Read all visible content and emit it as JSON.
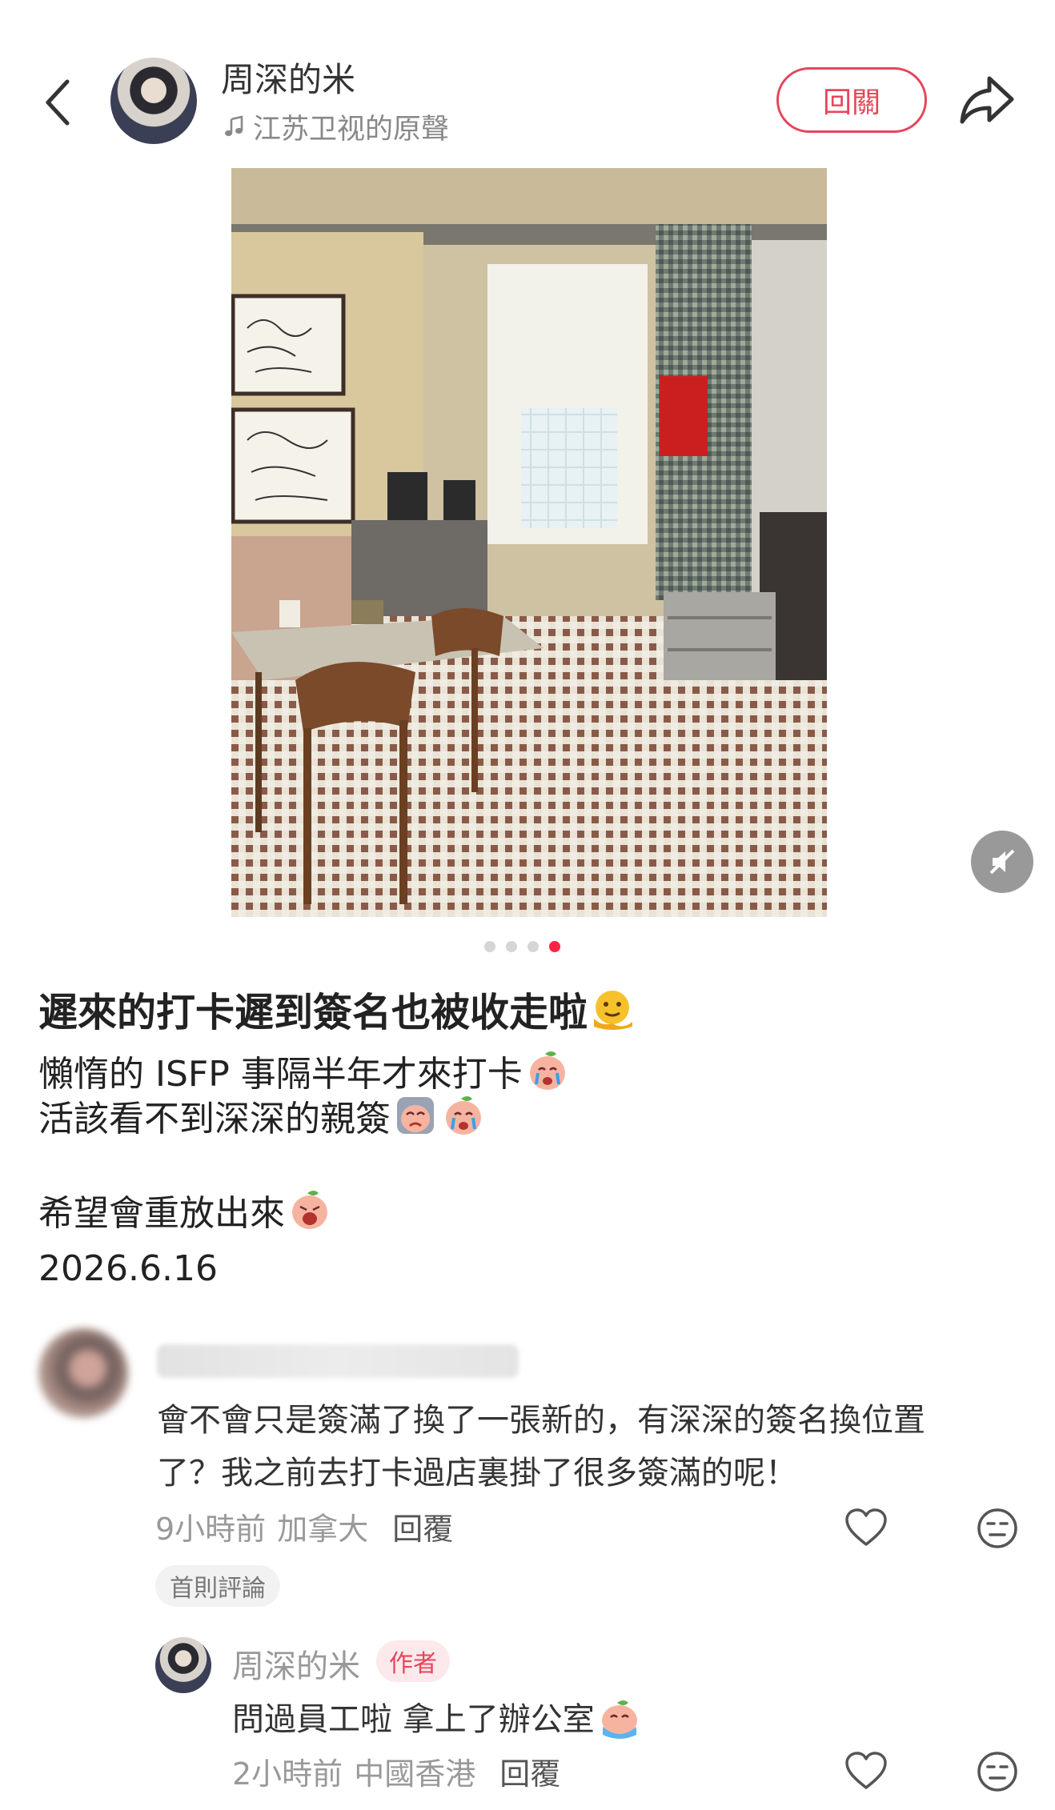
{
  "header": {
    "author_name": "周深的米",
    "music": "江苏卫视的原聲",
    "follow_label": "回關"
  },
  "carousel": {
    "total": 4,
    "current": 4
  },
  "post": {
    "title": "遲來的打卡遲到簽名也被收走啦",
    "lines": [
      "懶惰的 ISFP 事隔半年才來打卡",
      "活該看不到深深的親簽",
      "希望會重放出來"
    ],
    "date": "2026.6.16"
  },
  "comments": [
    {
      "text": "會不會只是簽滿了換了一張新的，有深深的簽名換位置了？我之前去打卡過店裏掛了很多簽滿的呢！",
      "time": "9小時前",
      "location": "加拿大",
      "reply_label": "回覆",
      "badge": "首則評論",
      "replies": [
        {
          "name": "周深的米",
          "author_badge": "作者",
          "text": "問過員工啦 拿上了辦公室",
          "time": "2小時前",
          "location": "中國香港",
          "reply_label": "回覆"
        }
      ]
    }
  ],
  "colors": {
    "accent": "#e5465a",
    "active_dot": "#ff2442",
    "meta_text": "#999999"
  },
  "icons": [
    "back-icon",
    "music-note-icon",
    "share-icon",
    "mute-icon",
    "heart-icon",
    "dislike-face-icon"
  ]
}
